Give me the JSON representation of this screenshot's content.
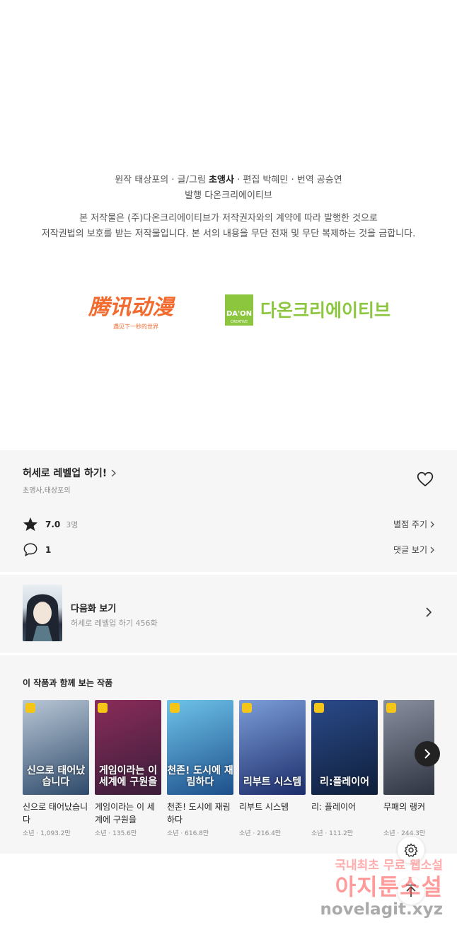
{
  "credits": {
    "original_label": "원작",
    "original_name": "태상포의",
    "art_label": "글/그림",
    "art_name": "초앵사",
    "edit_label": "편집",
    "edit_name": "박혜민",
    "translate_label": "번역",
    "translate_name": "공승연",
    "publisher_label": "발행",
    "publisher_name": "다온크리에이티브",
    "separator": "·"
  },
  "notice": {
    "line1": "본 저작물은 (주)다온크리에이티브가 저작권자와의 계약에 따라 발행한 것으로",
    "line2": "저작권법의 보호를 받는 저작물입니다. 본 서의 내용을 무단 전재 및 무단 복제하는 것을 금합니다."
  },
  "logos": {
    "tencent": {
      "main": "腾讯动漫",
      "tagline": "遇见下一秒的世界",
      "color": "#f26a2e"
    },
    "daon": {
      "badge_top": "DA'ON",
      "badge_bottom": "CREATIVE",
      "text": "다온크리에이티브",
      "color": "#8cc63f"
    }
  },
  "work": {
    "title": "허세로 레벨업 하기!",
    "authors": "초앵사,태상포의",
    "rating": "7.0",
    "raters": "3명",
    "rate_action": "별점 주기",
    "comments": "1",
    "comment_action": "댓글 보기"
  },
  "next_episode": {
    "label": "다음화 보기",
    "subtitle": "허세로 레벨업 하기 456화"
  },
  "recommendations": {
    "heading": "이 작품과 함께 보는 작품",
    "items": [
      {
        "title": "신으로 태어났습니다",
        "meta": "소년 · 1,093.2만",
        "cover_text": "신으로 태어났습니다",
        "c1": "#2e4a6b",
        "c2": "#b9c7d6"
      },
      {
        "title": "게임이라는 이 세계에 구원을",
        "meta": "소년 · 135.6만",
        "cover_text": "게임이라는 이 세계에 구원을",
        "c1": "#3a1d3a",
        "c2": "#8a2c5a"
      },
      {
        "title": "천존! 도시에 재림하다",
        "meta": "소년 · 616.8만",
        "cover_text": "천존! 도시에 재림하다",
        "c1": "#1d4f8a",
        "c2": "#6ec3ea"
      },
      {
        "title": "리부트 시스템",
        "meta": "소년 · 216.4만",
        "cover_text": "리부트 시스템",
        "c1": "#1c2c6b",
        "c2": "#7b9ed8"
      },
      {
        "title": "리: 플레이어",
        "meta": "소년 · 111.2만",
        "cover_text": "리:플레이어",
        "c1": "#0f1f3a",
        "c2": "#2a4a8a"
      },
      {
        "title": "무패의 랭커",
        "meta": "소년 · 244.3만",
        "cover_text": "",
        "c1": "#2a2f3c",
        "c2": "#8a8fa0"
      }
    ]
  },
  "watermark": {
    "line1": "국내최초 무료 웹소설",
    "line2": "아지툰소설",
    "line3": "novelagit.xyz"
  }
}
